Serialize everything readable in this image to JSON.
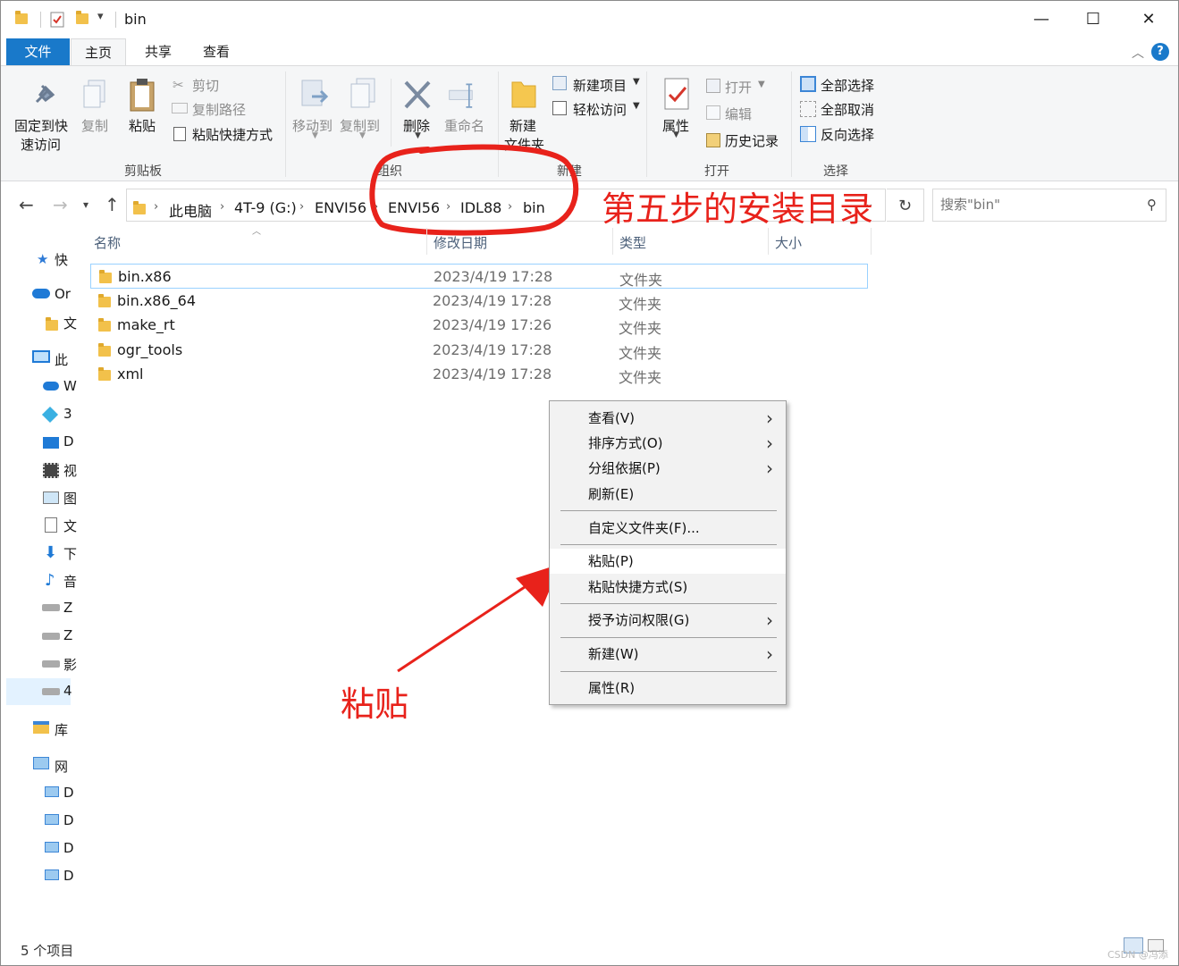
{
  "window": {
    "title": "bin"
  },
  "ribbon_tabs": [
    "文件",
    "主页",
    "共享",
    "查看"
  ],
  "ribbon": {
    "clipboard": {
      "pin": "固定到快速访问",
      "pin_line1": "固定到快",
      "pin_line2": "速访问",
      "copy": "复制",
      "paste": "粘贴",
      "cut": "剪切",
      "copy_path": "复制路径",
      "paste_shortcut": "粘贴快捷方式",
      "group": "剪贴板"
    },
    "organize": {
      "move_to": "移动到",
      "copy_to": "复制到",
      "delete": "删除",
      "rename": "重命名",
      "group": "组织"
    },
    "new": {
      "new_folder_line1": "新建",
      "new_folder_line2": "文件夹",
      "new_item": "新建项目",
      "easy_access": "轻松访问",
      "group": "新建"
    },
    "open": {
      "properties": "属性",
      "open": "打开",
      "edit": "编辑",
      "history": "历史记录",
      "group": "打开"
    },
    "select": {
      "select_all": "全部选择",
      "select_none": "全部取消",
      "invert": "反向选择",
      "group": "选择"
    }
  },
  "address": {
    "breadcrumbs": [
      "此电脑",
      "4T-9 (G:)",
      "ENVI56",
      "ENVI56",
      "IDL88",
      "bin"
    ],
    "search_placeholder": "搜索\"bin\""
  },
  "annotations": {
    "install_dir": "第五步的安装目录",
    "paste": "粘贴"
  },
  "nav_pane": [
    "快",
    "Or",
    "文",
    "此",
    "W",
    "3",
    "D",
    "视",
    "图",
    "文",
    "下",
    "音",
    "Z",
    "Z",
    "影",
    "4",
    "库",
    "网",
    "D",
    "D",
    "D",
    "D"
  ],
  "columns": [
    "名称",
    "修改日期",
    "类型",
    "大小"
  ],
  "files": [
    {
      "name": "bin.x86",
      "date": "2023/4/19 17:28",
      "type": "文件夹"
    },
    {
      "name": "bin.x86_64",
      "date": "2023/4/19 17:28",
      "type": "文件夹"
    },
    {
      "name": "make_rt",
      "date": "2023/4/19 17:26",
      "type": "文件夹"
    },
    {
      "name": "ogr_tools",
      "date": "2023/4/19 17:28",
      "type": "文件夹"
    },
    {
      "name": "xml",
      "date": "2023/4/19 17:28",
      "type": "文件夹"
    }
  ],
  "context_menu": {
    "view": "查看(V)",
    "sort": "排序方式(O)",
    "group": "分组依据(P)",
    "refresh": "刷新(E)",
    "customize": "自定义文件夹(F)...",
    "paste": "粘贴(P)",
    "paste_shortcut": "粘贴快捷方式(S)",
    "give_access": "授予访问权限(G)",
    "new": "新建(W)",
    "properties": "属性(R)"
  },
  "status": {
    "count": "5 个项目"
  },
  "watermark": "CSDN @冯添",
  "colors": {
    "accent": "#1979ca",
    "annotation": "#e8221b",
    "selection_border": "#99d1ff"
  }
}
